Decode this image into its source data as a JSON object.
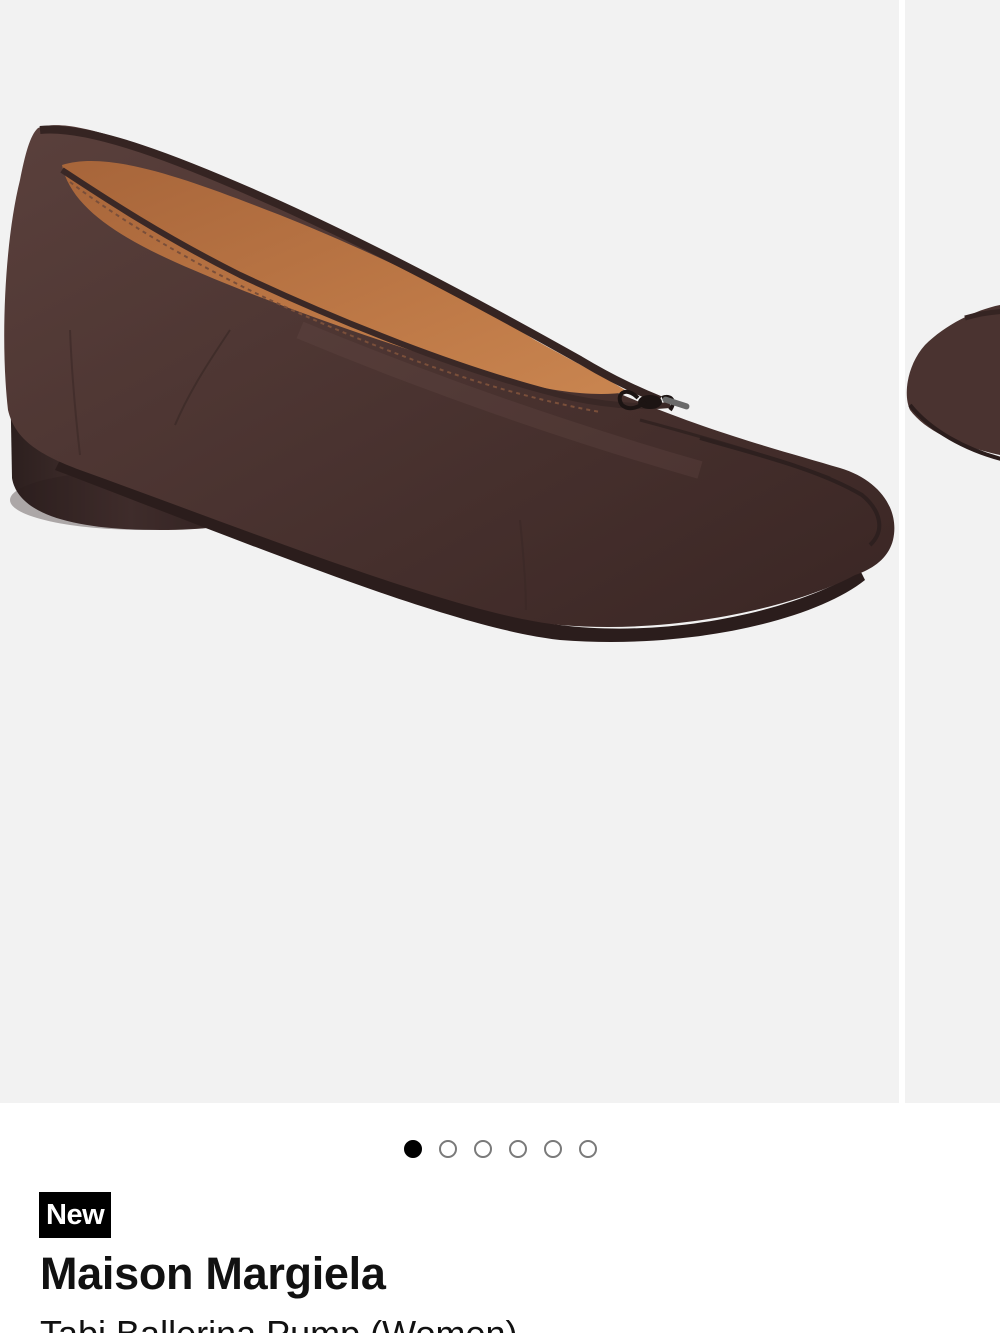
{
  "gallery": {
    "image_alt": "Brown leather split-toe ballerina pump with round block heel",
    "image_count": 6,
    "active_index": 0,
    "dots": [
      {
        "label": "Image 1"
      },
      {
        "label": "Image 2"
      },
      {
        "label": "Image 3"
      },
      {
        "label": "Image 4"
      },
      {
        "label": "Image 5"
      },
      {
        "label": "Image 6"
      }
    ]
  },
  "product": {
    "badge": "New",
    "brand": "Maison Margiela",
    "name": "Tabi Ballerina Pump (Women)"
  },
  "colors": {
    "image_background": "#f2f2f2",
    "leather": "#4a3330",
    "lining": "#b5713f",
    "heel": "#3a2a28",
    "badge_bg": "#000000",
    "badge_text": "#ffffff",
    "text": "#111111",
    "dot_active": "#000000",
    "dot_inactive": "#7a7a7a"
  }
}
